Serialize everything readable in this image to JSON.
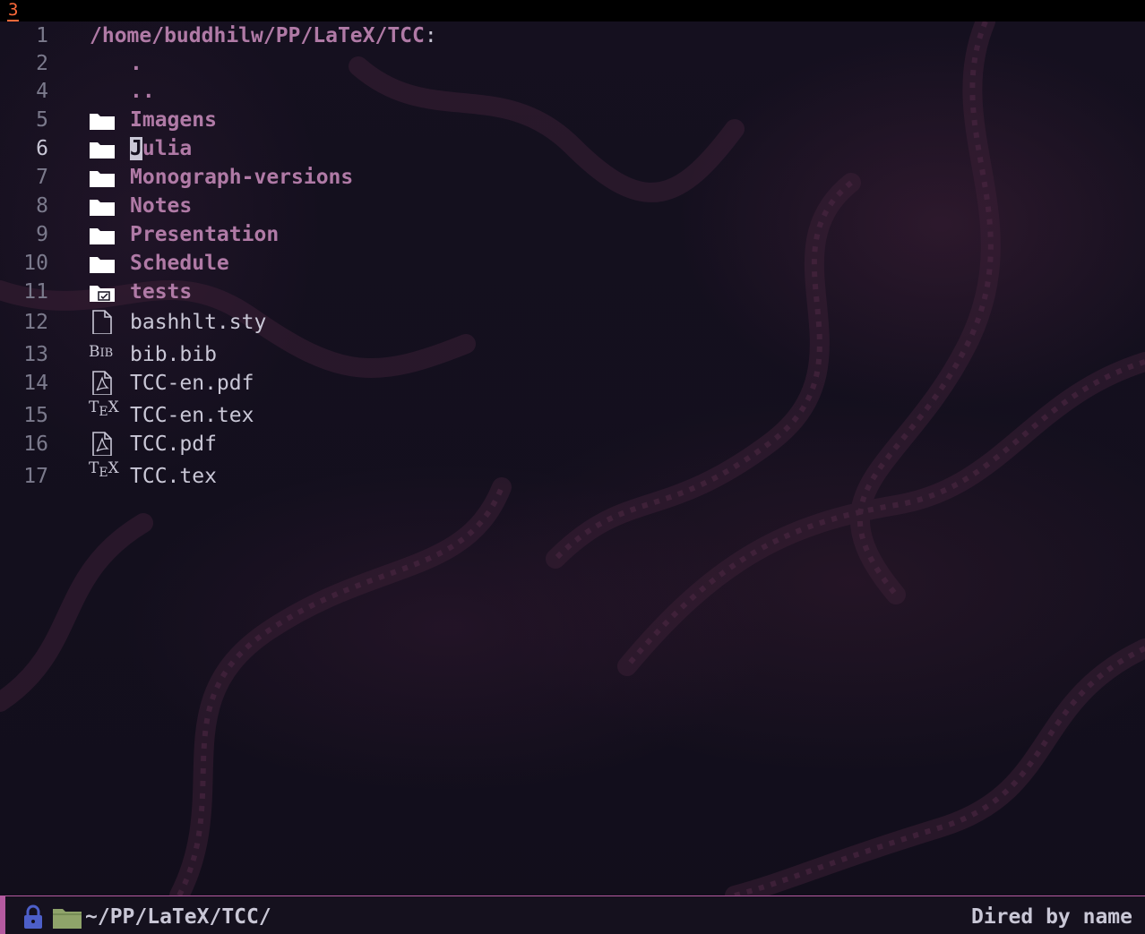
{
  "topbar": {
    "workspace": "3"
  },
  "dired": {
    "header": {
      "line": "1",
      "path": "/home/buddhilw/PP/LaTeX/TCC",
      "colon": ":"
    },
    "dot_entries": [
      {
        "line": "2",
        "name": "."
      },
      {
        "line": "4",
        "name": ".."
      }
    ],
    "entries": [
      {
        "line": "5",
        "name": "Imagens",
        "type": "dir",
        "icon": "folder-icon"
      },
      {
        "line": "6",
        "name": "Julia",
        "type": "dir",
        "icon": "folder-icon",
        "cursor": true
      },
      {
        "line": "7",
        "name": "Monograph-versions",
        "type": "dir",
        "icon": "folder-icon"
      },
      {
        "line": "8",
        "name": "Notes",
        "type": "dir",
        "icon": "folder-icon"
      },
      {
        "line": "9",
        "name": "Presentation",
        "type": "dir",
        "icon": "folder-icon"
      },
      {
        "line": "10",
        "name": "Schedule",
        "type": "dir",
        "icon": "folder-icon"
      },
      {
        "line": "11",
        "name": "tests",
        "type": "dir",
        "icon": "test-folder-icon"
      },
      {
        "line": "12",
        "name": "bashhlt.sty",
        "type": "file",
        "icon": "file-icon"
      },
      {
        "line": "13",
        "name": "bib.bib",
        "type": "file",
        "icon": "bibtex-icon",
        "icon_text": "BIB"
      },
      {
        "line": "14",
        "name": "TCC-en.pdf",
        "type": "file",
        "icon": "pdf-icon"
      },
      {
        "line": "15",
        "name": "TCC-en.tex",
        "type": "file",
        "icon": "tex-icon",
        "icon_text": "TEX"
      },
      {
        "line": "16",
        "name": "TCC.pdf",
        "type": "file",
        "icon": "pdf-icon"
      },
      {
        "line": "17",
        "name": "TCC.tex",
        "type": "file",
        "icon": "tex-icon",
        "icon_text": "TEX"
      }
    ]
  },
  "modeline": {
    "path": "~/PP/LaTeX/TCC/",
    "mode": "Dired by name",
    "lock_icon": "lock-icon",
    "folder_icon": "folder-icon"
  },
  "colors": {
    "accent": "#b45aa0",
    "directory": "#b07aa6",
    "foreground": "#c9c7d6",
    "line_number": "#7b7a8c",
    "workspace": "#ff6a3a",
    "background": "#14101f"
  }
}
